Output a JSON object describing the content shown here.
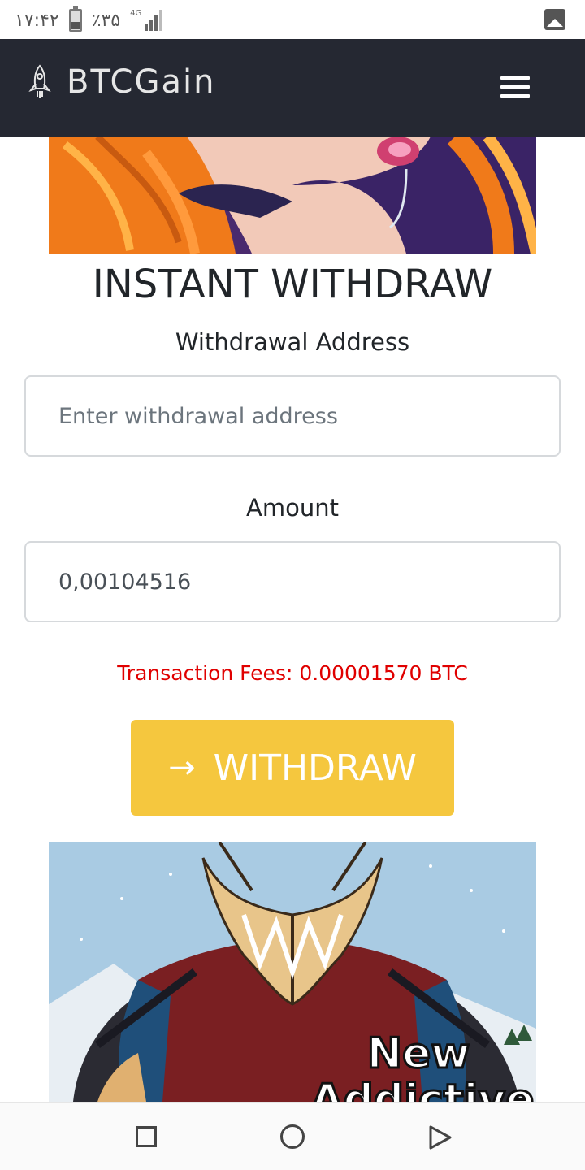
{
  "status_bar": {
    "time": "۱۷:۴۲",
    "battery": "٪۳۵",
    "network": "4G",
    "icons": [
      "battery-icon",
      "signal-icon",
      "gallery-icon"
    ]
  },
  "navbar": {
    "brand": "BTCGain",
    "logo_icon": "rocket-icon",
    "menu_icon": "hamburger-menu-icon",
    "background": "#252832"
  },
  "form": {
    "title": "INSTANT WITHDRAW",
    "address_label": "Withdrawal Address",
    "address_placeholder": "Enter withdrawal address",
    "address_value": "",
    "amount_label": "Amount",
    "amount_value": "0,00104516",
    "fees_text": "Transaction Fees: 0.00001570 BTC",
    "withdraw_label": "WITHDRAW",
    "withdraw_icon": "arrow-right-icon",
    "accent_color": "#f5c73e",
    "fees_color": "#e00000"
  },
  "ads": {
    "bottom_caption_line1": "New",
    "bottom_caption_line2": "Addictive"
  },
  "system_nav": {
    "icons": [
      "recent-apps-icon",
      "home-icon",
      "back-icon"
    ]
  }
}
